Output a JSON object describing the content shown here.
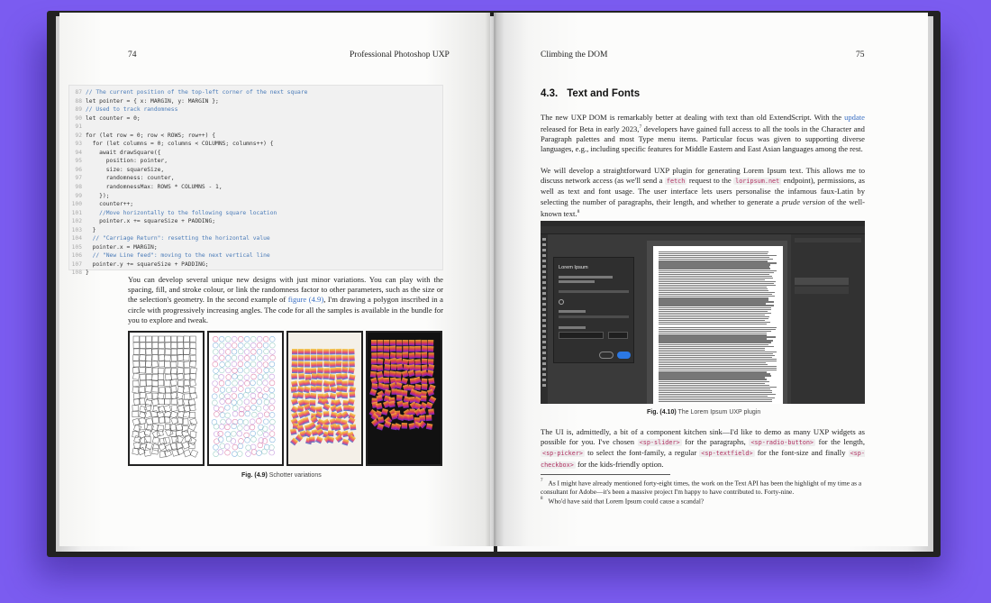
{
  "left_page": {
    "page_number": "74",
    "running_head": "Professional Photoshop UXP",
    "code_lines": [
      {
        "n": "87",
        "t": "// The current position of the top-left corner of the next square",
        "c": true
      },
      {
        "n": "88",
        "t": "let pointer = { x: MARGIN, y: MARGIN };",
        "c": false
      },
      {
        "n": "89",
        "t": "// Used to track randomness",
        "c": true
      },
      {
        "n": "90",
        "t": "let counter = 0;",
        "c": false
      },
      {
        "n": "91",
        "t": "",
        "c": false
      },
      {
        "n": "92",
        "t": "for (let row = 0; row < ROWS; row++) {",
        "c": false
      },
      {
        "n": "93",
        "t": "  for (let columns = 0; columns < COLUMNS; columns++) {",
        "c": false
      },
      {
        "n": "94",
        "t": "    await drawSquare({",
        "c": false
      },
      {
        "n": "95",
        "t": "      position: pointer,",
        "c": false
      },
      {
        "n": "96",
        "t": "      size: squareSize,",
        "c": false
      },
      {
        "n": "97",
        "t": "      randomness: counter,",
        "c": false
      },
      {
        "n": "98",
        "t": "      randomnessMax: ROWS * COLUMNS - 1,",
        "c": false
      },
      {
        "n": "99",
        "t": "    });",
        "c": false
      },
      {
        "n": "100",
        "t": "    counter++;",
        "c": false
      },
      {
        "n": "101",
        "t": "    //Move horizontally to the following square location",
        "c": true
      },
      {
        "n": "102",
        "t": "    pointer.x += squareSize + PADDING;",
        "c": false
      },
      {
        "n": "103",
        "t": "  }",
        "c": false
      },
      {
        "n": "104",
        "t": "  // \"Carriage Return\": resetting the horizontal value",
        "c": true
      },
      {
        "n": "105",
        "t": "  pointer.x = MARGIN;",
        "c": false
      },
      {
        "n": "106",
        "t": "  // \"New Line feed\": moving to the next vertical line",
        "c": true
      },
      {
        "n": "107",
        "t": "  pointer.y += squareSize + PADDING;",
        "c": false
      },
      {
        "n": "108",
        "t": "}",
        "c": false
      }
    ],
    "paragraph_a": "You can develop several unique new designs with just minor variations. You can play with the spacing, fill, and stroke colour, or link the randomness factor to other parameters, such as the size or the selection's geometry. In the second example of",
    "paragraph_link": "figure (4.9)",
    "paragraph_b": ", I'm drawing a polygon inscribed in a circle with progressively increasing angles. The code for all the samples is available in the bundle for you to explore and tweak.",
    "figure_label": "Fig. (4.9)",
    "figure_caption": "Schotter variations"
  },
  "right_page": {
    "page_number": "75",
    "running_head": "Climbing the DOM",
    "section_number": "4.3.",
    "section_title": "Text and Fonts",
    "p1_a": "The new UXP DOM is remarkably better at dealing with text than old ExtendScript. With the",
    "p1_link": "update",
    "p1_b": "released for Beta in early 2023,",
    "p1_sup": "7",
    "p1_c": "developers have gained full access to all the tools in the Character and Paragraph palettes and most Type menu items. Particular focus was given to supporting diverse languages, e.g., including specific features for Middle Eastern and East Asian languages among the rest.",
    "p2_a": "We will develop a straightforward UXP plugin for generating Lorem Ipsum text. This allows me to discuss network access (as we'll send a",
    "p2_code1": "fetch",
    "p2_b": "request to the",
    "p2_code2": "loripsum.net",
    "p2_c": "endpoint), permissions, as well as text and font usage. The user interface lets users personalise the infamous faux-Latin by selecting the number of paragraphs, their length, and whether to generate a",
    "p2_em": "prude version",
    "p2_d": "of the well-known text.",
    "p2_sup": "8",
    "screenshot_dialog_title": "Lorem Ipsum",
    "figure_label": "Fig. (4.10)",
    "figure_caption": "The Lorem Ipsum UXP plugin",
    "p3_a": "The UI is, admittedly, a bit of a component kitchen sink—I'd like to demo as many UXP widgets as possible for you. I've chosen",
    "p3_code1": "<sp-slider>",
    "p3_b": "for the paragraphs,",
    "p3_code2": "<sp-radio-button>",
    "p3_c": "for the length,",
    "p3_code3": "<sp-picker>",
    "p3_d": "to select the font-family, a regular",
    "p3_code4": "<sp-textfield>",
    "p3_e": "for the font-size and finally",
    "p3_code5": "<sp-checkbox>",
    "p3_f": "for the kids-friendly option.",
    "footnote_7_num": "7",
    "footnote_7": "As I might have already mentioned forty-eight times, the work on the Text API has been the highlight of my time as a consultant for Adobe—it's been a massive project I'm happy to have contributed to. Forty-nine.",
    "footnote_8_num": "8",
    "footnote_8": "Who'd have said that Lorem Ipsum could cause a scandal?"
  },
  "colors": {
    "background": "#7b5cf0",
    "link": "#3a6fc4",
    "code_comment": "#4a7bb8",
    "inline_code": "#b03060"
  }
}
